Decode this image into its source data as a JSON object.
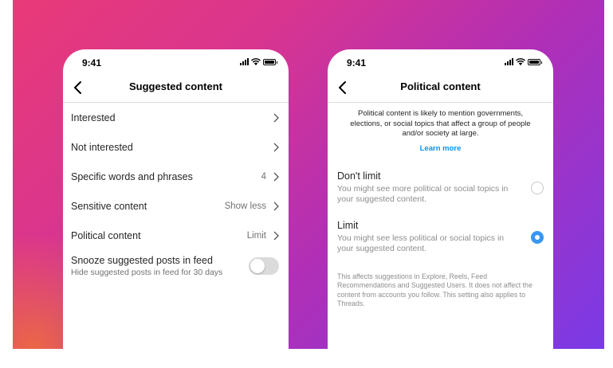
{
  "colors": {
    "accent": "#0095f6",
    "radio_on": "#3797f0",
    "toggle_off": "#dbdbdb"
  },
  "left_phone": {
    "status": {
      "time": "9:41"
    },
    "title": "Suggested content",
    "rows": [
      {
        "label": "Interested",
        "value": ""
      },
      {
        "label": "Not interested",
        "value": ""
      },
      {
        "label": "Specific words and phrases",
        "value": "4"
      },
      {
        "label": "Sensitive content",
        "value": "Show less"
      },
      {
        "label": "Political content",
        "value": "Limit"
      }
    ],
    "snooze": {
      "label": "Snooze suggested posts in feed",
      "sublabel": "Hide suggested posts in feed for 30 days",
      "enabled": false
    }
  },
  "right_phone": {
    "status": {
      "time": "9:41"
    },
    "title": "Political content",
    "description": "Political content is likely to mention governments, elections, or social topics that affect a group of people and/or society at large.",
    "learn_more": "Learn more",
    "options": [
      {
        "label": "Don't limit",
        "description": "You might see more political or social topics in your suggested content.",
        "selected": false
      },
      {
        "label": "Limit",
        "description": "You might see less political or social topics in your suggested content.",
        "selected": true
      }
    ],
    "footnote": "This affects suggestions in Explore, Reels, Feed Recommendations and Suggested Users. It does not affect the content from accounts you follow. This setting also applies to Threads."
  }
}
